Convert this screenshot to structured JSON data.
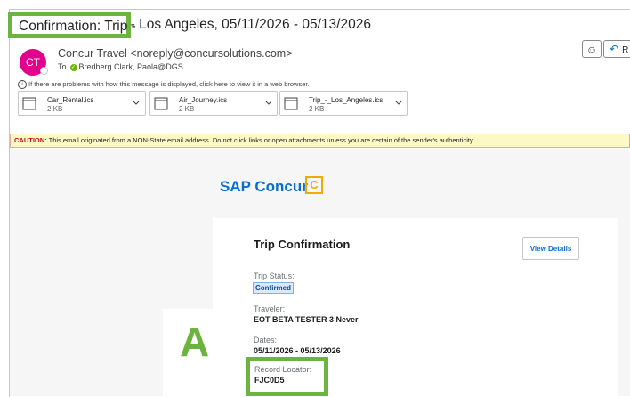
{
  "subject": {
    "full": "Confirmation: Trip - Los Angeles, 05/11/2026 - 05/13/2026",
    "highlighted": "Confirmation: Trip -"
  },
  "sender": {
    "initials": "CT",
    "from": "Concur Travel <noreply@concursolutions.com>",
    "to_label": "To",
    "to_name": "Bredberg Clark, Paola@DGS"
  },
  "toolbar": {
    "reply_label": "R"
  },
  "infobar": "If there are problems with how this message is displayed, click here to view it in a web browser.",
  "attachments": [
    {
      "name": "Car_Rental.ics",
      "size": "2 KB"
    },
    {
      "name": "Air_Journey.ics",
      "size": "2 KB"
    },
    {
      "name": "Trip_-_Los_Angeles.ics",
      "size": "2 KB"
    }
  ],
  "caution": {
    "label": "CAUTION:",
    "text": " This email originated from a NON-State email address. Do not click links or open attachments unless you are certain of the sender's authenticity."
  },
  "email": {
    "logo": "SAP Concur",
    "title": "Trip Confirmation",
    "view_details": "View Details",
    "trip_status_label": "Trip Status:",
    "trip_status": "Confirmed",
    "traveler_label": "Traveler:",
    "traveler": "EOT BETA TESTER 3 Never",
    "dates_label": "Dates:",
    "dates": "05/11/2026 - 05/13/2026",
    "record_locator_label": "Record Locator:",
    "record_locator": "FJC0D5"
  },
  "callout": {
    "letter": "A"
  },
  "colors": {
    "highlight": "#6db33f",
    "brand": "#0a6ed1",
    "avatar": "#e3008c",
    "caution_bg": "#fdf9c4"
  }
}
